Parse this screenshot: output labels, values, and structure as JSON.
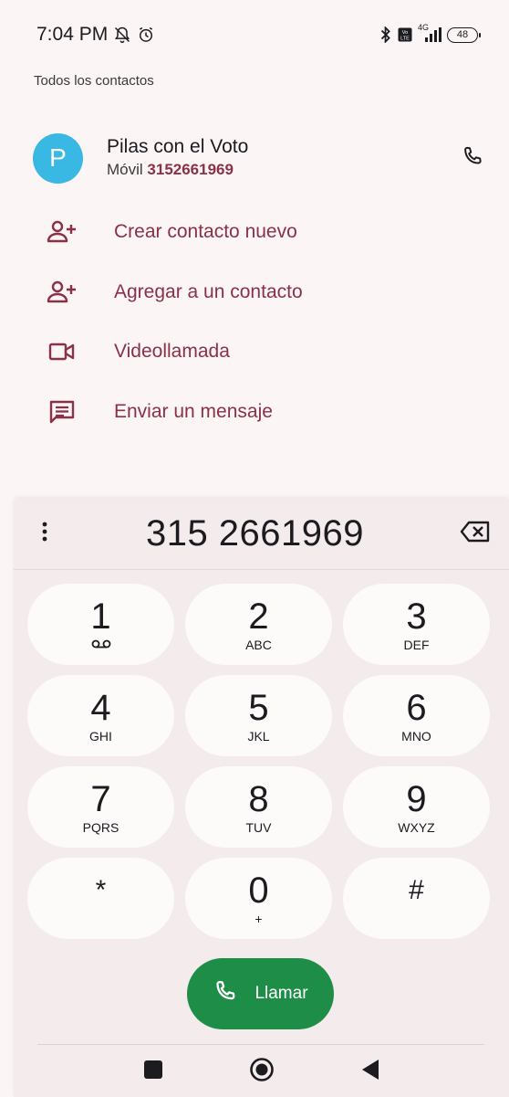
{
  "status_bar": {
    "time": "7:04 PM",
    "signal_label": "4G",
    "battery": "48"
  },
  "section_heading": "Todos los contactos",
  "contact": {
    "initial": "P",
    "name": "Pilas con el Voto",
    "type_label": "Móvil",
    "number": "3152661969",
    "avatar_color": "#39b8e4"
  },
  "actions": [
    {
      "label": "Crear contacto nuevo",
      "icon": "add-person-icon"
    },
    {
      "label": "Agregar a un contacto",
      "icon": "add-person-icon"
    },
    {
      "label": "Videollamada",
      "icon": "video-camera-icon"
    },
    {
      "label": "Enviar un mensaje",
      "icon": "message-icon"
    }
  ],
  "dialer": {
    "number": "315 2661969",
    "keys": [
      {
        "digit": "1",
        "letters": ""
      },
      {
        "digit": "2",
        "letters": "ABC"
      },
      {
        "digit": "3",
        "letters": "DEF"
      },
      {
        "digit": "4",
        "letters": "GHI"
      },
      {
        "digit": "5",
        "letters": "JKL"
      },
      {
        "digit": "6",
        "letters": "MNO"
      },
      {
        "digit": "7",
        "letters": "PQRS"
      },
      {
        "digit": "8",
        "letters": "TUV"
      },
      {
        "digit": "9",
        "letters": "WXYZ"
      },
      {
        "digit": "*",
        "letters": ""
      },
      {
        "digit": "0",
        "letters": "+"
      },
      {
        "digit": "#",
        "letters": ""
      }
    ],
    "call_label": "Llamar"
  },
  "colors": {
    "accent": "#8a3148",
    "call_green": "#1e8d47",
    "background": "#fbf5f5",
    "dialpad_bg": "#f4ecec"
  }
}
